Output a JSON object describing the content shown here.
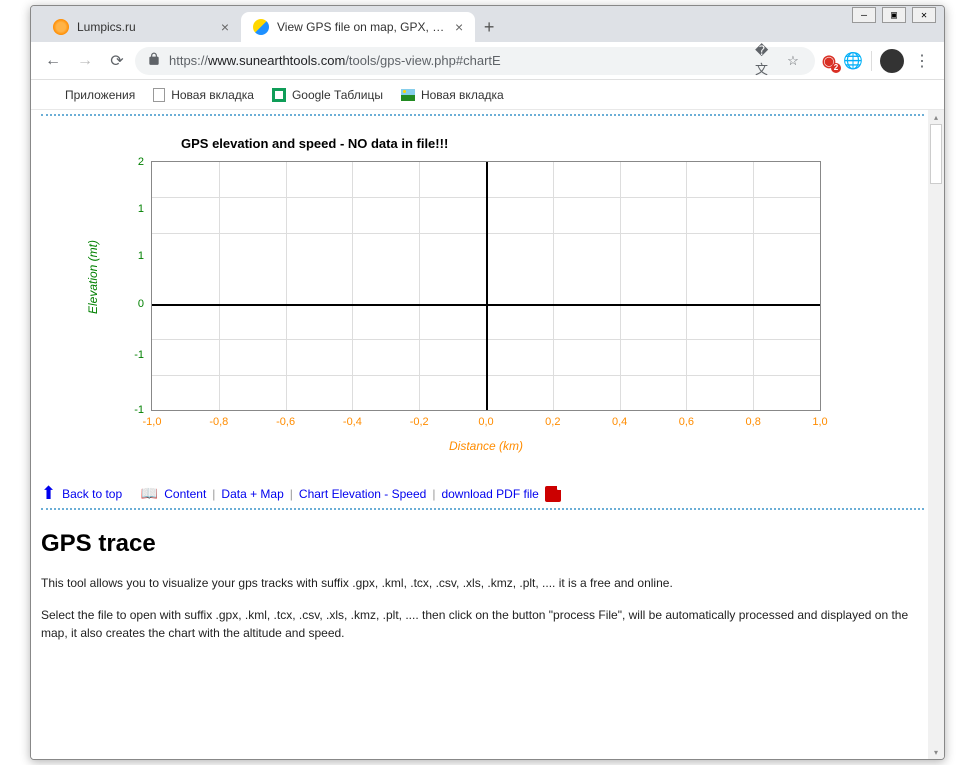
{
  "window_controls": {
    "min": "—",
    "max": "▣",
    "close": "✕"
  },
  "tabs": [
    {
      "title": "Lumpics.ru",
      "active": false
    },
    {
      "title": "View GPS file on map, GPX, KML",
      "active": true
    }
  ],
  "urlbar": {
    "protocol": "https://",
    "host": "www.sunearthtools.com",
    "path": "/tools/gps-view.php#chartE"
  },
  "bookmarks": [
    {
      "label": "Приложения"
    },
    {
      "label": "Новая вкладка"
    },
    {
      "label": "Google Таблицы"
    },
    {
      "label": "Новая вкладка"
    }
  ],
  "chart_data": {
    "type": "line",
    "title": "GPS elevation and speed - NO data in file!!!",
    "xlabel": "Distance (km)",
    "ylabel": "Elevation (mt)",
    "x_ticks": [
      "-1,0",
      "-0,8",
      "-0,6",
      "-0,4",
      "-0,2",
      "0,0",
      "0,2",
      "0,4",
      "0,6",
      "0,8",
      "1,0"
    ],
    "y_ticks": [
      "-1",
      "-1",
      "0",
      "1",
      "1",
      "2"
    ],
    "xlim": [
      -1.0,
      1.0
    ],
    "ylim": [
      -1.5,
      2.0
    ],
    "series": []
  },
  "navlinks": {
    "back_to_top": "Back to top",
    "content": "Content",
    "data_map": "Data + Map",
    "chart": "Chart Elevation - Speed",
    "pdf": "download PDF file"
  },
  "heading": "GPS trace",
  "para1": "This tool allows you to visualize your gps tracks with suffix .gpx, .kml, .tcx, .csv, .xls, .kmz, .plt, .... it is a free and online.",
  "para2": "Select the file to open with suffix .gpx, .kml, .tcx, .csv, .xls, .kmz, .plt, .... then click on the button \"process File\", will be automatically processed and displayed on the map, it also creates the chart with the altitude and speed."
}
